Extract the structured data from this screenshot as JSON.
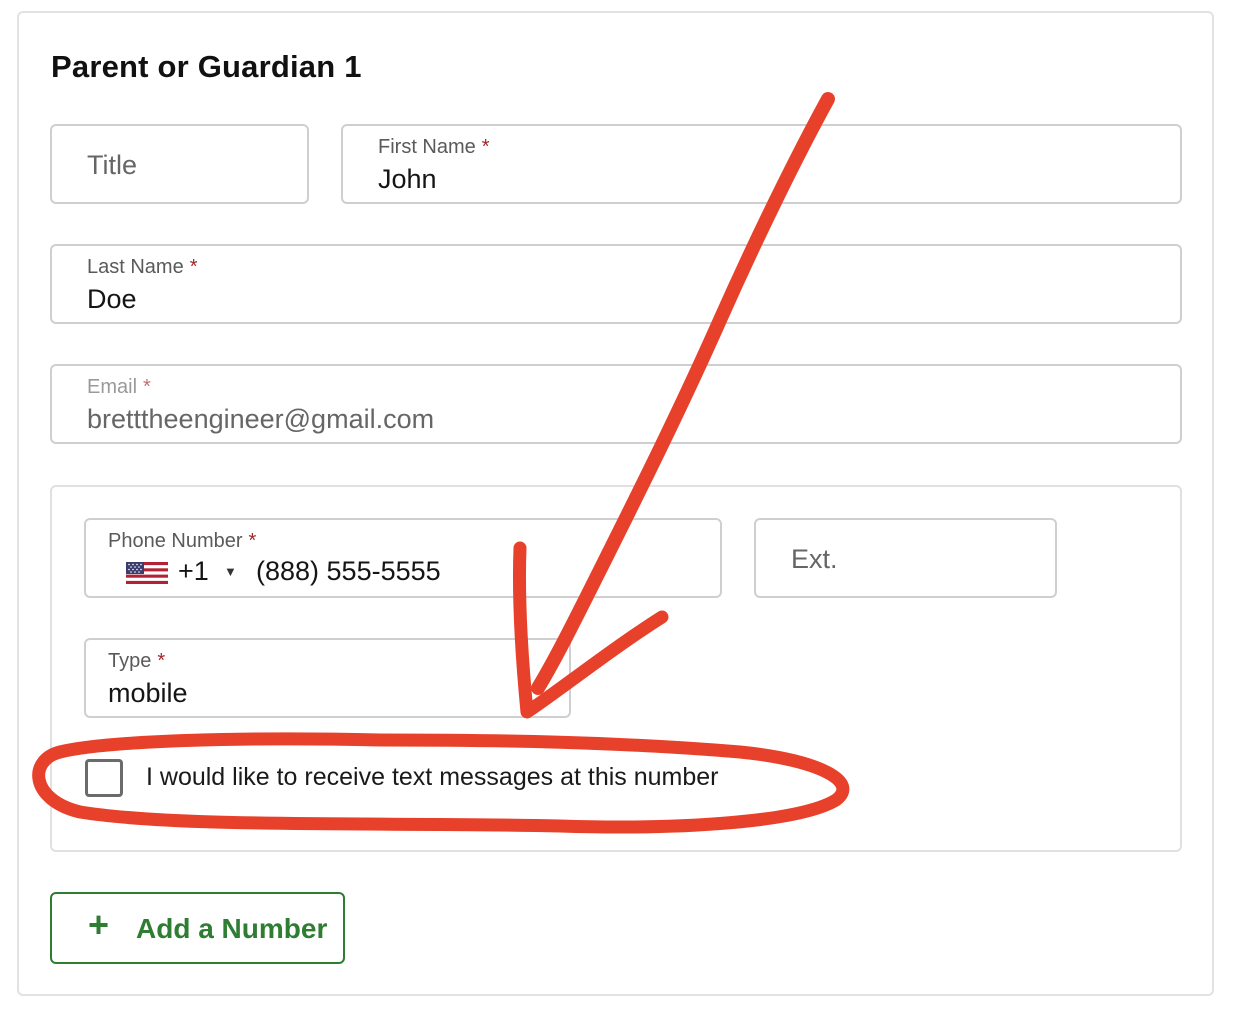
{
  "section": {
    "title": "Parent or Guardian 1"
  },
  "fields": {
    "title": {
      "placeholder": "Title"
    },
    "first_name": {
      "label": "First Name",
      "required_mark": "*",
      "value": "John"
    },
    "last_name": {
      "label": "Last Name",
      "required_mark": "*",
      "value": "Doe"
    },
    "email": {
      "label": "Email",
      "required_mark": "*",
      "value": "bretttheengineer@gmail.com"
    }
  },
  "phone": {
    "label": "Phone Number",
    "required_mark": "*",
    "flag_icon": "us-flag-icon",
    "country_code": "+1",
    "caret": "▼",
    "value": "(888) 555-5555",
    "ext_placeholder": "Ext.",
    "type_label": "Type",
    "type_required_mark": "*",
    "type_value": "mobile",
    "sms_opt_in_label": "I would like to receive text messages at this number",
    "sms_opt_in_checked": false
  },
  "add_number": {
    "icon": "plus-icon",
    "plus_glyph": "+",
    "label": "Add a Number"
  },
  "colors": {
    "accent_green": "#2e7d32",
    "required_red": "#a32626",
    "annotation_red": "#e8412b",
    "field_border": "#cfcfcf"
  }
}
